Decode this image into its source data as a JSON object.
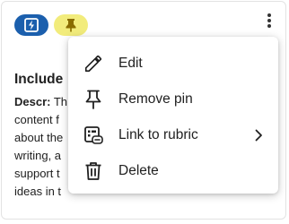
{
  "card": {
    "chips": [
      {
        "icon": "flash-icon",
        "color": "#1b5fad"
      },
      {
        "icon": "pin-icon",
        "color": "#f2ec7c"
      }
    ],
    "more_icon": "vertical-dots-icon",
    "title": "Include",
    "description_label": "Descr:",
    "description_lines": [
      "Th",
      "content f",
      "about the",
      "writing, a",
      "support t",
      "ideas in t"
    ]
  },
  "menu": {
    "items": [
      {
        "label": "Edit",
        "icon": "pencil-icon"
      },
      {
        "label": "Remove pin",
        "icon": "pin-icon"
      },
      {
        "label": "Link to rubric",
        "icon": "rubric-link-icon",
        "has_submenu": true
      },
      {
        "label": "Delete",
        "icon": "trash-icon"
      }
    ]
  }
}
